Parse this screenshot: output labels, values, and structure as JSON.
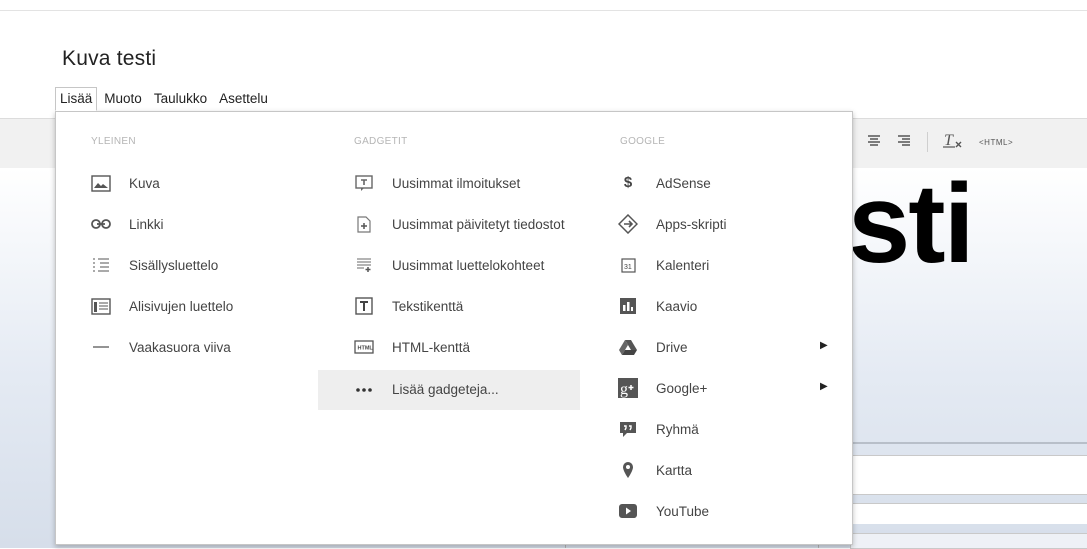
{
  "document": {
    "title": "Kuva testi",
    "heading_fragment": "sti"
  },
  "menubar": {
    "tabs": [
      {
        "label": "Lisää",
        "active": true
      },
      {
        "label": "Muoto"
      },
      {
        "label": "Taulukko"
      },
      {
        "label": "Asettelu"
      }
    ]
  },
  "toolbar": {
    "html_label": "<HTML>"
  },
  "insert_menu": {
    "columns": [
      {
        "header": "YLEINEN",
        "items": [
          {
            "label": "Kuva",
            "icon": "image-icon"
          },
          {
            "label": "Linkki",
            "icon": "link-icon"
          },
          {
            "label": "Sisällysluettelo",
            "icon": "toc-icon"
          },
          {
            "label": "Alisivujen luettelo",
            "icon": "subpage-list-icon"
          },
          {
            "label": "Vaakasuora viiva",
            "icon": "horizontal-line-icon"
          }
        ]
      },
      {
        "header": "GADGETIT",
        "items": [
          {
            "label": "Uusimmat ilmoitukset",
            "icon": "announcements-icon"
          },
          {
            "label": "Uusimmat päivitetyt tiedostot",
            "icon": "file-update-icon"
          },
          {
            "label": "Uusimmat luettelokohteet",
            "icon": "list-items-icon"
          },
          {
            "label": "Tekstikenttä",
            "icon": "text-box-icon"
          },
          {
            "label": "HTML-kenttä",
            "icon": "html-box-icon"
          },
          {
            "label": "Lisää gadgeteja...",
            "icon": "more-icon",
            "highlighted": true
          }
        ]
      },
      {
        "header": "GOOGLE",
        "items": [
          {
            "label": "AdSense",
            "icon": "adsense-icon"
          },
          {
            "label": "Apps-skripti",
            "icon": "apps-script-icon"
          },
          {
            "label": "Kalenteri",
            "icon": "calendar-icon"
          },
          {
            "label": "Kaavio",
            "icon": "chart-icon"
          },
          {
            "label": "Drive",
            "icon": "drive-icon",
            "submenu": true
          },
          {
            "label": "Google+",
            "icon": "google-plus-icon",
            "submenu": true
          },
          {
            "label": "Ryhmä",
            "icon": "groups-icon"
          },
          {
            "label": "Kartta",
            "icon": "map-pin-icon"
          },
          {
            "label": "YouTube",
            "icon": "youtube-icon"
          }
        ]
      }
    ]
  }
}
